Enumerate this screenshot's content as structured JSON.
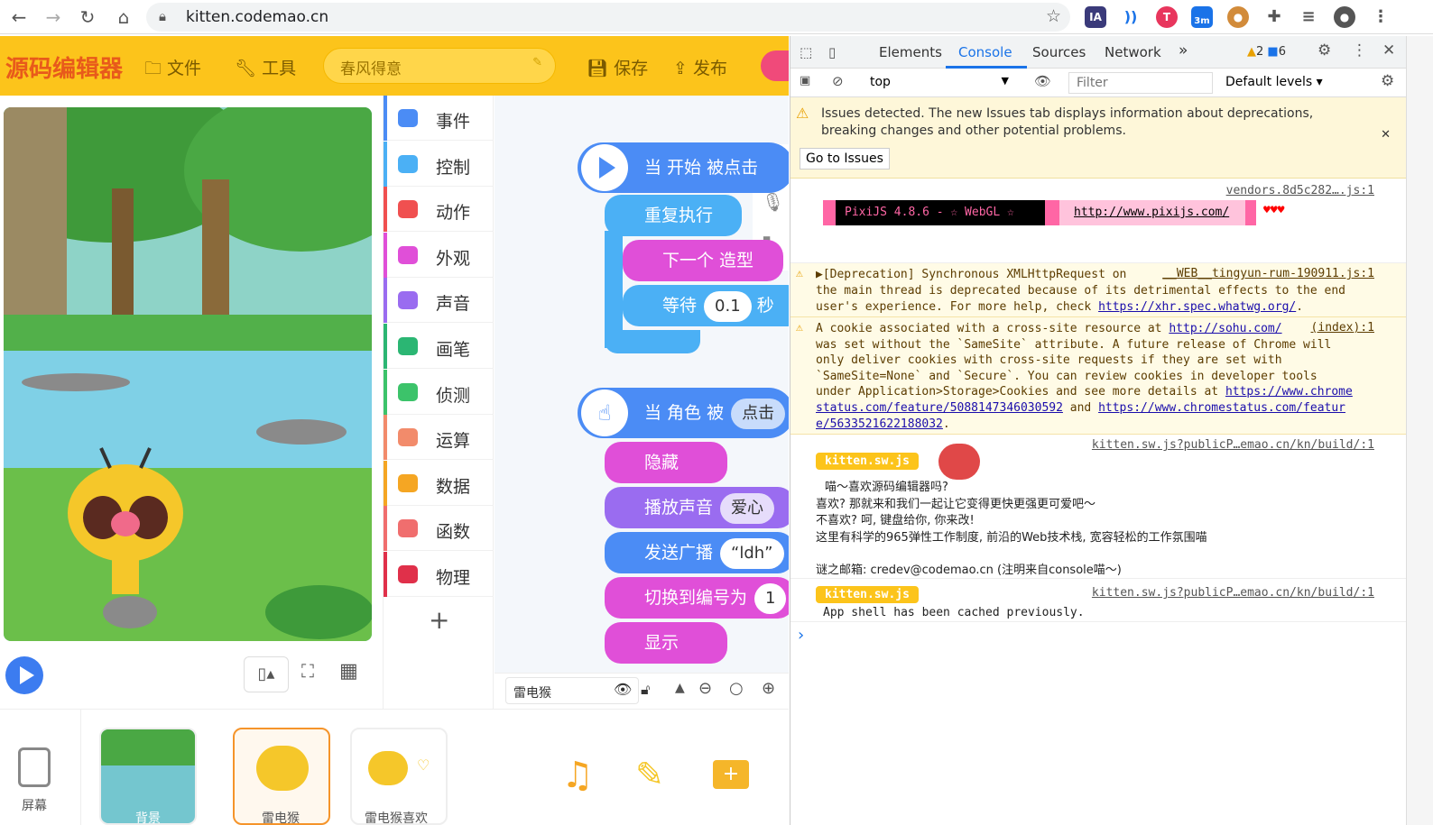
{
  "browser": {
    "url": "kitten.codemao.cn",
    "ext_ia": "IA",
    "ext_badge": "3m"
  },
  "editor": {
    "logo": "源码编辑器",
    "menu_file": "文件",
    "menu_tools": "工具",
    "project_name": "春风得意",
    "save": "保存",
    "publish": "发布",
    "categories": [
      {
        "label": "事件",
        "color": "#4b8cf5"
      },
      {
        "label": "控制",
        "color": "#4bb0f5"
      },
      {
        "label": "动作",
        "color": "#f05050"
      },
      {
        "label": "外观",
        "color": "#e04fd8"
      },
      {
        "label": "声音",
        "color": "#9a6cf0"
      },
      {
        "label": "画笔",
        "color": "#2bb673"
      },
      {
        "label": "侦测",
        "color": "#3cc36a"
      },
      {
        "label": "运算",
        "color": "#f28b6b"
      },
      {
        "label": "数据",
        "color": "#f5a623"
      },
      {
        "label": "函数",
        "color": "#f06e6e"
      },
      {
        "label": "物理",
        "color": "#e0304a"
      }
    ],
    "add_category": "+",
    "blocks": {
      "hat1": "当 开始 被点击",
      "repeat": "重复执行",
      "next_costume": "下一个 造型",
      "wait": "等待",
      "wait_value": "0.1",
      "wait_unit": "秒",
      "hat2": "当 角色 被",
      "hat2_opt": "点击",
      "hide": "隐藏",
      "play_sound": "播放声音",
      "sound_opt": "爱心",
      "broadcast": "发送广播",
      "broadcast_opt": "“ldh”",
      "switch": "切换到编号为",
      "switch_val": "1",
      "show": "显示"
    },
    "sprite_name": "雷电猴",
    "bottom": {
      "screen": "屏幕",
      "background": "背景",
      "sprite1": "雷电猴",
      "sprite2": "雷电猴喜欢"
    }
  },
  "devtools": {
    "tabs": [
      "Elements",
      "Console",
      "Sources",
      "Network"
    ],
    "more": "»",
    "warn_count": "2",
    "info_count": "6",
    "context": "top",
    "filter_placeholder": "Filter",
    "levels": "Default levels",
    "issues_text": "Issues detected. The new Issues tab displays information about deprecations, breaking changes and other potential problems.",
    "issues_btn": "Go to Issues",
    "msg1_src": "vendors.8d5c282….js:1",
    "pixi_label": "PixiJS 4.8.6 - ☆ WebGL ☆",
    "pixi_link": "http://www.pixijs.com/",
    "pixi_hearts": "♥♥♥",
    "msg2_src": "__WEB__tingyun-rum-190911.js:1",
    "msg2_line1": "▶[Deprecation] Synchronous XMLHttpRequest on",
    "msg2_line2": "the main thread is deprecated because of its detrimental effects to the end",
    "msg2_line3": "user's experience. For more help, check",
    "msg2_link": "https://xhr.spec.whatwg.org/",
    "msg3_src": "(index):1",
    "msg3_a": "A cookie associated with a cross-site resource at",
    "msg3_link1": "http://sohu.com/",
    "msg3_lines": [
      "was set without the `SameSite` attribute. A future release of Chrome will",
      "only deliver cookies with cross-site requests if they are set with",
      "`SameSite=None` and `Secure`. You can review cookies in developer tools",
      "under Application>Storage>Cookies and see more details at"
    ],
    "msg3_link2a": "https://www.chrome",
    "msg3_link2b": "status.com/feature/5088147346030592",
    "msg3_and": "and",
    "msg3_link3a": "https://www.chromestatus.com/featur",
    "msg3_link3b": "e/5633521622188032",
    "kitten_badge": "kitten.sw.js",
    "kitten_src": "kitten.sw.js?publicP…emao.cn/kn/build/:1",
    "kitten_lines": [
      "喵～喜欢源码编辑器吗?",
      "喜欢? 那就来和我们一起让它变得更快更强更可爱吧～",
      "不喜欢? 呵, 键盘给你, 你来改!",
      "这里有科学的965弹性工作制度, 前沿的Web技术栈, 宽容轻松的工作氛围喵",
      "",
      "谜之邮箱: credev@codemao.cn (注明来自console喵～)"
    ],
    "cache_text": "App shell has been cached previously.",
    "prompt": "›"
  }
}
